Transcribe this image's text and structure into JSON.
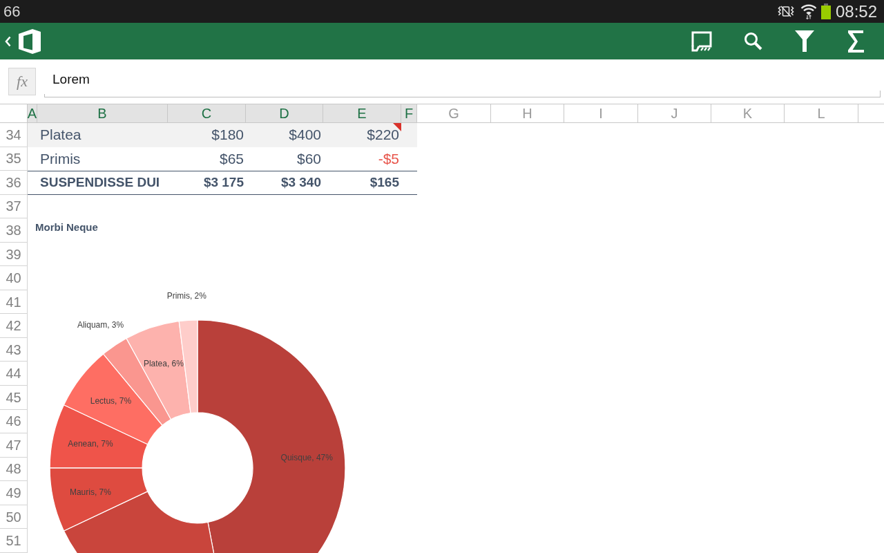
{
  "status_bar": {
    "indicator": "66",
    "time": "08:52"
  },
  "formula_bar": {
    "function_label": "fx",
    "value": "Lorem"
  },
  "column_headers": [
    {
      "label": "A",
      "selected": true
    },
    {
      "label": "B",
      "selected": true
    },
    {
      "label": "C",
      "selected": true
    },
    {
      "label": "D",
      "selected": true
    },
    {
      "label": "E",
      "selected": true
    },
    {
      "label": "F",
      "selected": true
    },
    {
      "label": "G",
      "selected": false
    },
    {
      "label": "H",
      "selected": false
    },
    {
      "label": "I",
      "selected": false
    },
    {
      "label": "J",
      "selected": false
    },
    {
      "label": "K",
      "selected": false
    },
    {
      "label": "L",
      "selected": false
    }
  ],
  "row_numbers": [
    "34",
    "35",
    "36",
    "37",
    "38",
    "39",
    "40",
    "41",
    "42",
    "43",
    "44",
    "45",
    "46",
    "47",
    "48",
    "49",
    "50",
    "51"
  ],
  "table": {
    "rows": [
      {
        "kind": "banded",
        "cells": [
          {
            "text": "Platea",
            "negative": false,
            "comment": false
          },
          {
            "text": "$180",
            "negative": false,
            "comment": false
          },
          {
            "text": "$400",
            "negative": false,
            "comment": false
          },
          {
            "text": "$220",
            "negative": false,
            "comment": true
          }
        ]
      },
      {
        "kind": "plain",
        "cells": [
          {
            "text": "Primis",
            "negative": false,
            "comment": false
          },
          {
            "text": "$65",
            "negative": false,
            "comment": false
          },
          {
            "text": "$60",
            "negative": false,
            "comment": false
          },
          {
            "text": "-$5",
            "negative": true,
            "comment": false
          }
        ]
      },
      {
        "kind": "total",
        "cells": [
          {
            "text": "SUSPENDISSE DUI",
            "negative": false,
            "comment": false
          },
          {
            "text": "$3 175",
            "negative": false,
            "comment": false
          },
          {
            "text": "$3 340",
            "negative": false,
            "comment": false
          },
          {
            "text": "$165",
            "negative": false,
            "comment": false
          }
        ]
      }
    ]
  },
  "chart": {
    "chart_data": {
      "type": "donut",
      "title": "Morbi Neque",
      "values": [
        47,
        21,
        7,
        7,
        7,
        3,
        6,
        2
      ],
      "colors": [
        "#b9403a",
        "#c9453c",
        "#de4b40",
        "#ef544a",
        "#fe6e63",
        "#fa968f",
        "#fdb2ad",
        "#fecdca"
      ],
      "value_labels": [
        "Quisque, 47%",
        null,
        "Mauris, 7%",
        "Aenean, 7%",
        "Lectus, 7%",
        "Aliquam, 3%",
        "Platea, 6%",
        "Primis, 2%"
      ]
    }
  }
}
